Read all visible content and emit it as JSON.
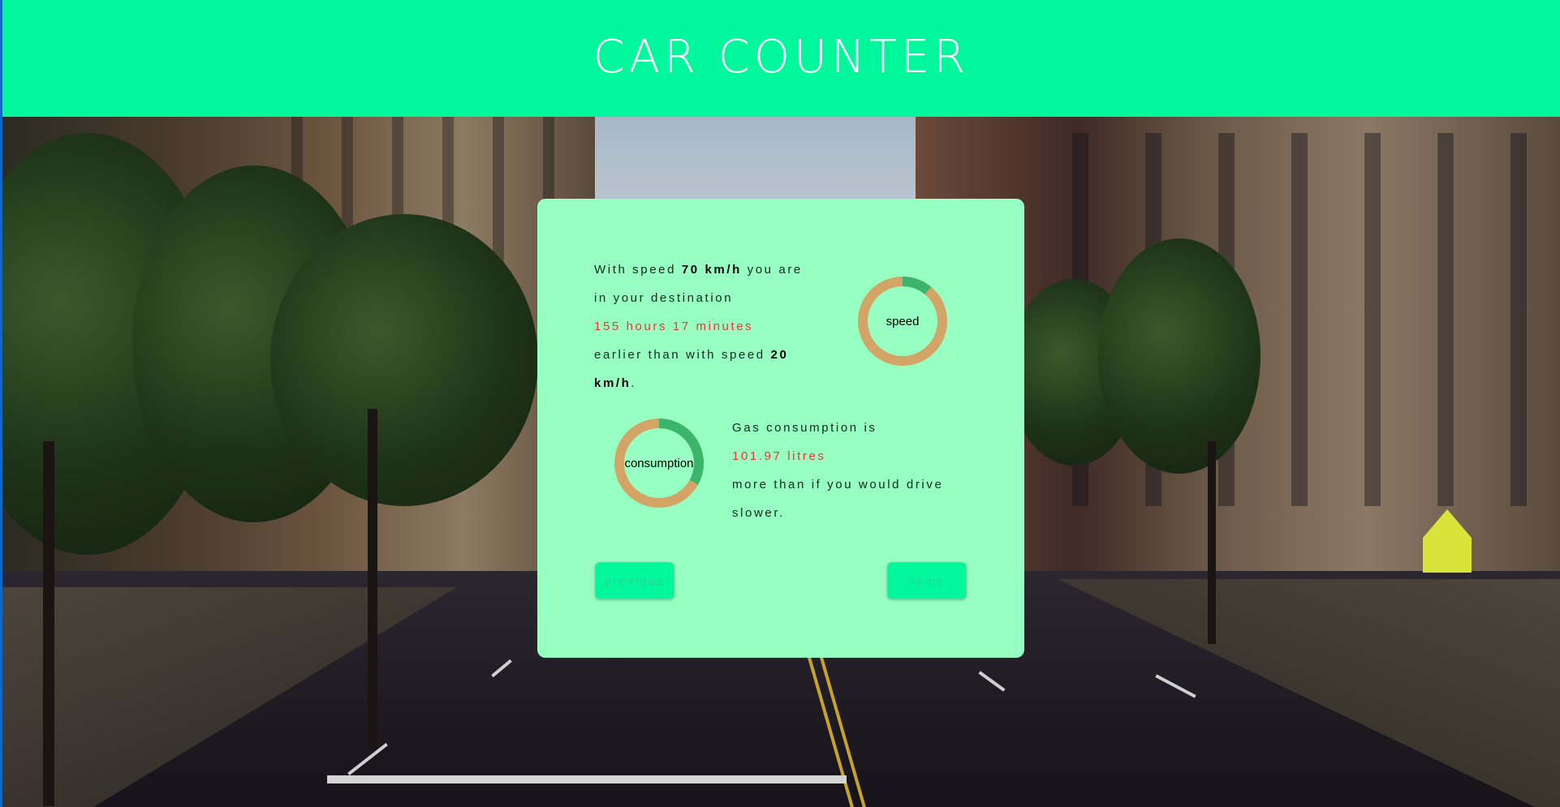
{
  "app": {
    "title": "CAR COUNTER"
  },
  "colors": {
    "header": "#00f79c",
    "card": "#96ffc1",
    "highlight": "#ec3636",
    "ring_track": "#d4a466",
    "ring_fill": "#3bb56a"
  },
  "speed_section": {
    "line1_pre": "With speed ",
    "fast_speed": "70 km/h",
    "line1_post": " you are",
    "line2": "in your destination",
    "time_saved": "155 hours 17 minutes",
    "line4_pre": "earlier than with speed ",
    "slow_speed_num": "20",
    "slow_speed_unit": "km/h",
    "period": ".",
    "donut_label": "speed",
    "donut_fraction": 0.11
  },
  "consumption_section": {
    "line1": "Gas consumption is",
    "amount": "101.97 litres",
    "line3": "more than if you would drive",
    "line4": "slower.",
    "donut_label": "consumption",
    "donut_fraction": 0.33
  },
  "buttons": {
    "previous": "previous",
    "home": "home"
  }
}
